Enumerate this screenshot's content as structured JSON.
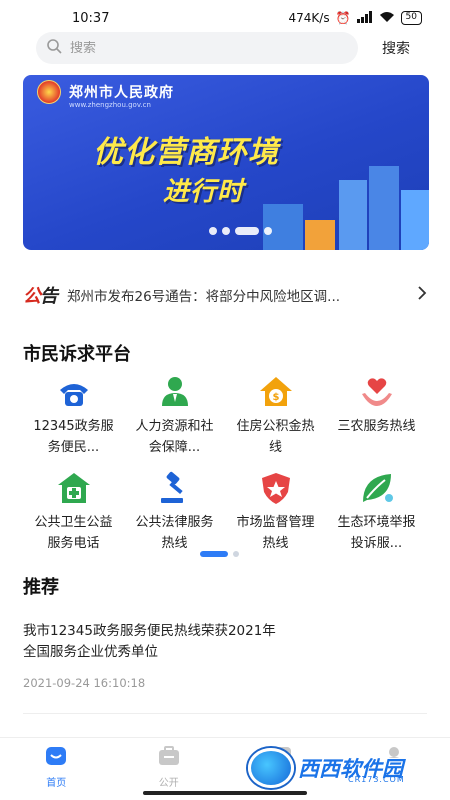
{
  "status_bar": {
    "time": "10:37",
    "speed": "474K/s",
    "battery": "50"
  },
  "search": {
    "placeholder": "搜索",
    "button_label": "搜索"
  },
  "banner": {
    "org_name": "郑州市人民政府",
    "url": "www.zhengzhou.gov.cn",
    "slogan_line1": "优化营商环境",
    "slogan_line2": "进行时",
    "slide_count": 4,
    "active_slide": 3
  },
  "notice": {
    "tag_red": "公",
    "tag_black": "告",
    "text": "郑州市发布26号通告：将部分中风险地区调..."
  },
  "services_section": {
    "title": "市民诉求平台",
    "items": [
      {
        "label": "12345政务服务便民...",
        "icon": "phone-icon",
        "color": "#1e63d6"
      },
      {
        "label": "人力资源和社会保障...",
        "icon": "person-icon",
        "color": "#2fa84f"
      },
      {
        "label": "住房公积金热线",
        "icon": "house-coin-icon",
        "color": "#f2a20c"
      },
      {
        "label": "三农服务热线",
        "icon": "heart-hand-icon",
        "color": "#e64545"
      },
      {
        "label": "公共卫生公益服务电话",
        "icon": "health-icon",
        "color": "#2fa84f"
      },
      {
        "label": "公共法律服务热线",
        "icon": "gavel-icon",
        "color": "#1e63d6"
      },
      {
        "label": "市场监督管理热线",
        "icon": "shield-star-icon",
        "color": "#e64545"
      },
      {
        "label": "生态环境举报投诉服...",
        "icon": "leaf-icon",
        "color": "#2fa84f"
      }
    ],
    "page_count": 2,
    "active_page": 1
  },
  "recommend": {
    "title": "推荐",
    "article_title": "我市12345政务服务便民热线荣获2021年全国服务企业优秀单位",
    "article_time": "2021-09-24 16:10:18"
  },
  "bottom_nav": {
    "items": [
      {
        "label": "首页",
        "icon": "home-icon",
        "active": true
      },
      {
        "label": "公开",
        "icon": "briefcase-icon",
        "active": false
      },
      {
        "label": "",
        "icon": "chat-icon",
        "active": false
      },
      {
        "label": "",
        "icon": "user-icon",
        "active": false
      }
    ]
  },
  "watermark": {
    "text": "西西软件园",
    "sub": "CR173.COM"
  },
  "colors": {
    "accent": "#2e7cf6",
    "notice_red": "#d62a1f",
    "banner_blue": "#2547c9",
    "slogan_yellow": "#ffe94a"
  }
}
